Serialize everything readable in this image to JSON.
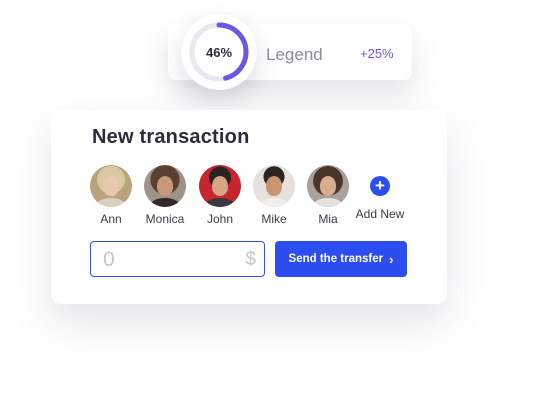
{
  "legend": {
    "percent_label": "46%",
    "percent_value": 46,
    "label": "Legend",
    "delta": "+25%",
    "gauge_color": "#6f55e6",
    "track_color": "#e8e8ee"
  },
  "transaction": {
    "title": "New transaction",
    "contacts": [
      {
        "name": "Ann"
      },
      {
        "name": "Monica"
      },
      {
        "name": "John"
      },
      {
        "name": "Mike"
      },
      {
        "name": "Mia"
      }
    ],
    "add_label": "Add New",
    "add_icon": "plus-icon",
    "amount_placeholder": "0",
    "currency_symbol": "$",
    "send_label": "Send the transfer",
    "send_icon": "chevron-right-icon",
    "accent_color": "#2c4ef0"
  }
}
